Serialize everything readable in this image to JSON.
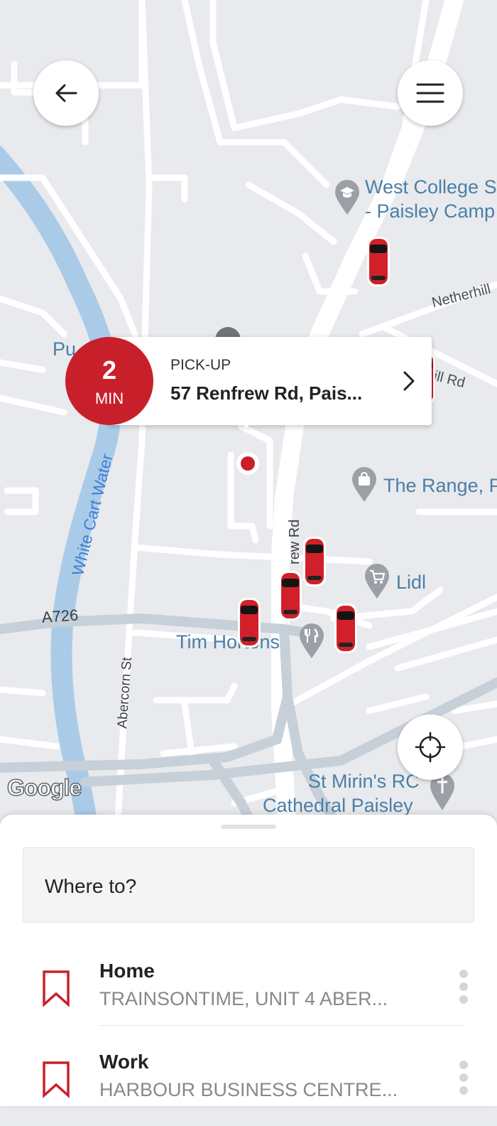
{
  "map": {
    "labels": {
      "west_college_1": "West College S",
      "west_college_2": "- Paisley Camp",
      "netherhill": "Netherhill",
      "netherhill_rd": "ill Rd",
      "the_range": "The Range, P",
      "lidl": "Lidl",
      "tim_hortons": "Tim Hortons",
      "st_mirins_1": "St Mirin's RC",
      "st_mirins_2": "Cathedral Paisley",
      "white_cart_water": "White Cart Water",
      "a726": "A726",
      "abercorn_st": "Abercorn St",
      "renfrew_rd": "rew Rd",
      "pu": "Pu"
    },
    "google_logo": "Google"
  },
  "pickup": {
    "eta_value": "2",
    "eta_unit": "MIN",
    "label": "PICK-UP",
    "address": "57 Renfrew Rd, Pais..."
  },
  "sheet": {
    "search_placeholder": "Where to?",
    "favorites": [
      {
        "title": "Home",
        "subtitle": "TRAINSONTIME, UNIT 4 ABER..."
      },
      {
        "title": "Work",
        "subtitle": "HARBOUR BUSINESS CENTRE..."
      }
    ]
  },
  "colors": {
    "accent": "#c8202b",
    "map_bg": "#e8eaed",
    "water": "#aacbe8",
    "poi": "#9aa0a6"
  }
}
